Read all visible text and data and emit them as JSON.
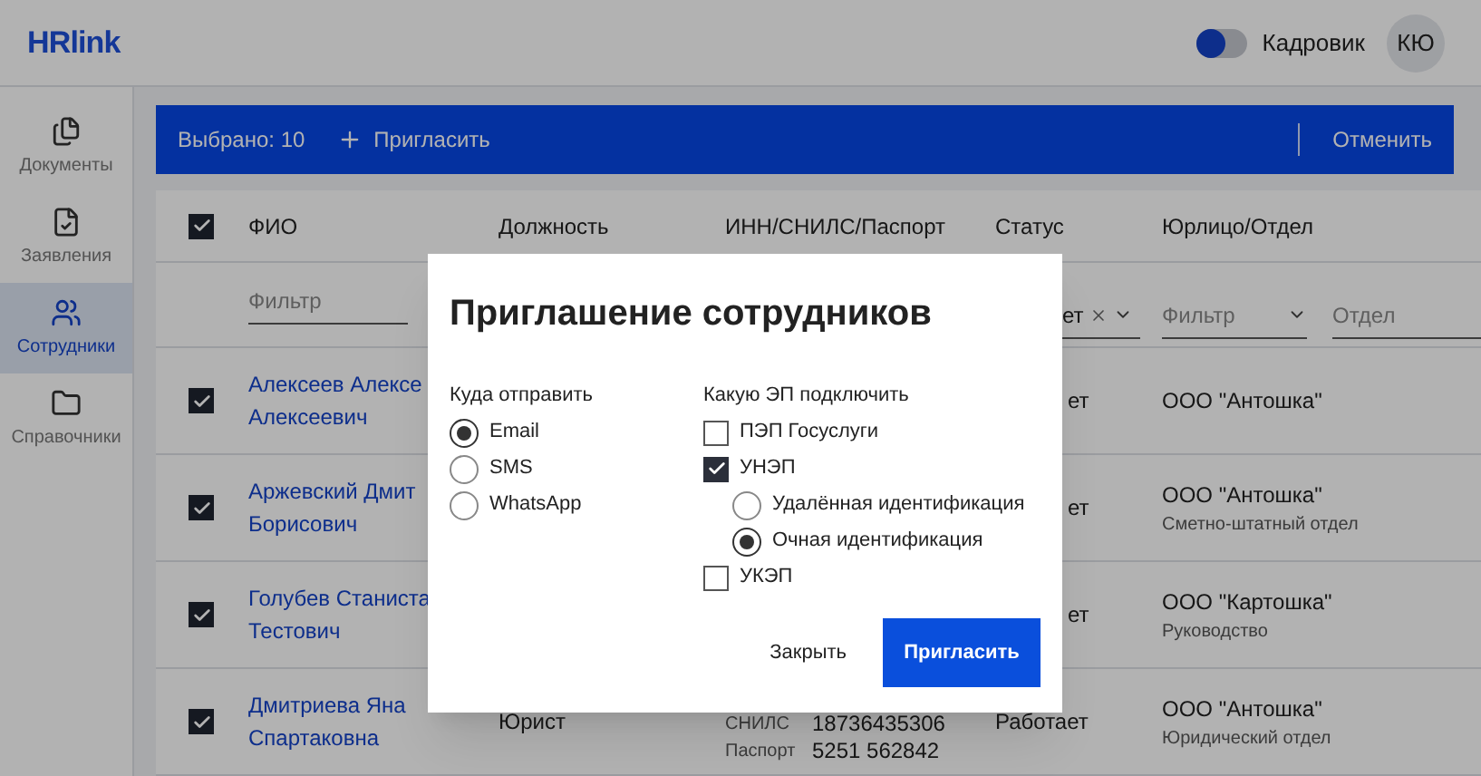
{
  "header": {
    "logo": "HRlink",
    "role_toggle": {
      "on": true,
      "label": "Кадровик"
    },
    "avatar": "КЮ"
  },
  "sidebar": {
    "items": [
      {
        "label": "Документы",
        "selected": false
      },
      {
        "label": "Заявления",
        "selected": false
      },
      {
        "label": "Сотрудники",
        "selected": true
      },
      {
        "label": "Справочники",
        "selected": false
      }
    ]
  },
  "action_bar": {
    "selected_count": "Выбрано: 10",
    "invite": "Пригласить",
    "cancel": "Отменить"
  },
  "table": {
    "select_all_checked": true,
    "columns": [
      "ФИО",
      "Должность",
      "ИНН/СНИЛС/Паспорт",
      "Статус",
      "Юрлицо/Отдел"
    ],
    "filters": {
      "name": {
        "placeholder": "Фильтр"
      },
      "status": {
        "value": "ет"
      },
      "org": {
        "placeholder": "Фильтр"
      },
      "department": {
        "placeholder": "Отдел"
      }
    },
    "rows": [
      {
        "checked": true,
        "name_lines": [
          "Алексеев Алексе",
          "Алексеевич"
        ],
        "status": "ет",
        "org": "ООО \"Антошка\""
      },
      {
        "checked": true,
        "name_lines": [
          "Аржевский Дмит",
          "Борисович"
        ],
        "status": "ет",
        "org": "ООО \"Антошка\"",
        "department": "Сметно-штатный отдел"
      },
      {
        "checked": true,
        "name_lines": [
          "Голубев Станиста",
          "Тестович"
        ],
        "status": "ет",
        "org": "ООО \"Картошка\"",
        "department": "Руководство"
      },
      {
        "checked": true,
        "name_lines": [
          "Дмитриева Яна",
          "Спартаковна"
        ],
        "position": "Юрист",
        "ids": [
          {
            "label": "СНИЛС",
            "value": "18736435306"
          },
          {
            "label": "Паспорт",
            "value": "5251 562842"
          }
        ],
        "status": "Работает",
        "org": "ООО \"Антошка\"",
        "department": "Юридический отдел"
      }
    ]
  },
  "modal": {
    "title": "Приглашение сотрудников",
    "send_to": {
      "label": "Куда отправить",
      "options": [
        {
          "label": "Email",
          "selected": true
        },
        {
          "label": "SMS",
          "selected": false
        },
        {
          "label": "WhatsApp",
          "selected": false
        }
      ]
    },
    "signature": {
      "label": "Какую ЭП подключить",
      "options": [
        {
          "label": "ПЭП Госуслуги",
          "checked": false
        },
        {
          "label": "УНЭП",
          "checked": true,
          "children": [
            {
              "label": "Удалённая идентификация",
              "selected": false
            },
            {
              "label": "Очная идентификация",
              "selected": true
            }
          ]
        },
        {
          "label": "УКЭП",
          "checked": false
        }
      ]
    },
    "close": "Закрыть",
    "invite": "Пригласить"
  }
}
